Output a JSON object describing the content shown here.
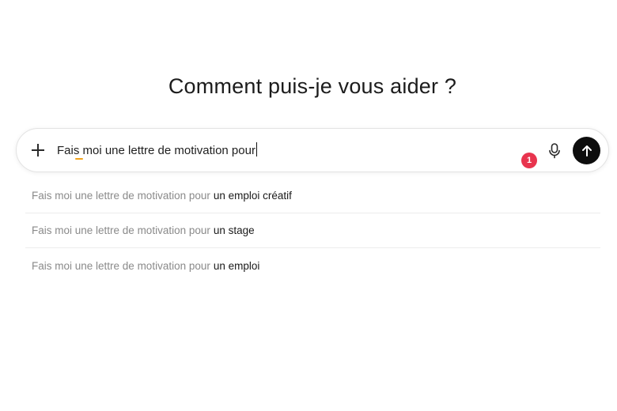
{
  "heading": "Comment puis-je vous aider ?",
  "composer": {
    "input_value": "Fais moi une lettre de motivation pour",
    "badge_count": "1",
    "icons": {
      "add": "plus-icon",
      "mic": "microphone-icon",
      "send": "arrow-up-icon"
    }
  },
  "suggestions": [
    {
      "prefix": "Fais moi une lettre de motivation pour",
      "completion": "un emploi créatif"
    },
    {
      "prefix": "Fais moi une lettre de motivation pour",
      "completion": "un stage"
    },
    {
      "prefix": "Fais moi une lettre de motivation pour",
      "completion": "un emploi"
    }
  ],
  "colors": {
    "send_button": "#0d0d0d",
    "badge": "#e8344e",
    "spellcheck_underline": "#f2a31b"
  }
}
